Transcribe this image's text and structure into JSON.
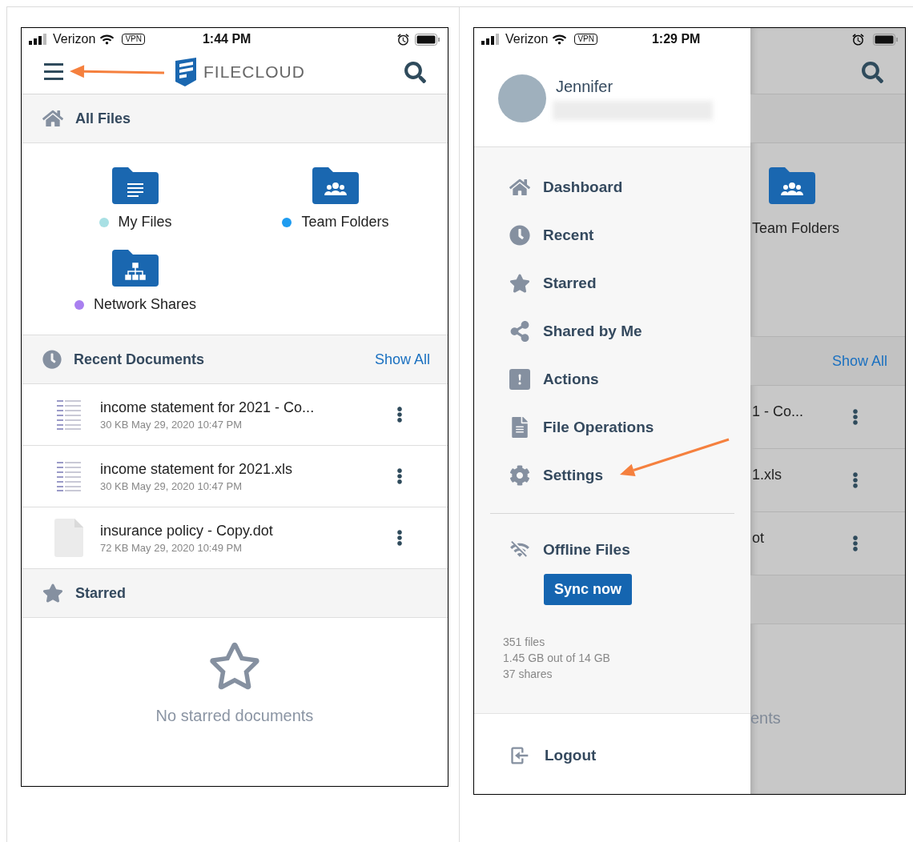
{
  "left_phone": {
    "status_bar": {
      "carrier": "Verizon",
      "vpn": "VPN",
      "time": "1:44 PM"
    },
    "header": {
      "logo_text": "FILECLOUD"
    },
    "all_files": {
      "title": "All Files",
      "folders": [
        {
          "kind": "documents",
          "label": "My Files",
          "color": "#a8e0e4"
        },
        {
          "kind": "team",
          "label": "Team Folders",
          "color": "#1f9cf0"
        },
        {
          "kind": "network",
          "label": "Network Shares",
          "color": "#a97ff0"
        }
      ]
    },
    "recent": {
      "title": "Recent Documents",
      "action": "Show All",
      "files": [
        {
          "kind": "spreadsheet",
          "name": "income statement for 2021 - Co...",
          "meta": "30 KB May 29, 2020 10:47 PM"
        },
        {
          "kind": "spreadsheet",
          "name": "income statement for 2021.xls",
          "meta": "30 KB May 29, 2020 10:47 PM"
        },
        {
          "kind": "blank",
          "name": "insurance policy - Copy.dot",
          "meta": "72 KB May 29, 2020 10:49 PM"
        }
      ]
    },
    "starred": {
      "title": "Starred",
      "empty_text": "No starred documents"
    }
  },
  "right_phone": {
    "status_bar": {
      "carrier": "Verizon",
      "vpn": "VPN",
      "time": "1:29 PM"
    },
    "profile": {
      "name": "Jennifer"
    },
    "menu": [
      {
        "kind": "home",
        "label": "Dashboard"
      },
      {
        "kind": "clock",
        "label": "Recent"
      },
      {
        "kind": "star",
        "label": "Starred"
      },
      {
        "kind": "share",
        "label": "Shared by Me"
      },
      {
        "kind": "alert",
        "label": "Actions"
      },
      {
        "kind": "file",
        "label": "File Operations"
      },
      {
        "kind": "gear",
        "label": "Settings"
      }
    ],
    "offline": {
      "label": "Offline Files",
      "button": "Sync now"
    },
    "stats": [
      "351 files",
      "1.45 GB out of 14 GB",
      "37 shares"
    ],
    "logout": "Logout",
    "background": {
      "folder_label": "Team Folders",
      "action": "Show All",
      "files": [
        "1 - Co...",
        "1.xls",
        "ot"
      ],
      "empty_text": "ents"
    }
  }
}
